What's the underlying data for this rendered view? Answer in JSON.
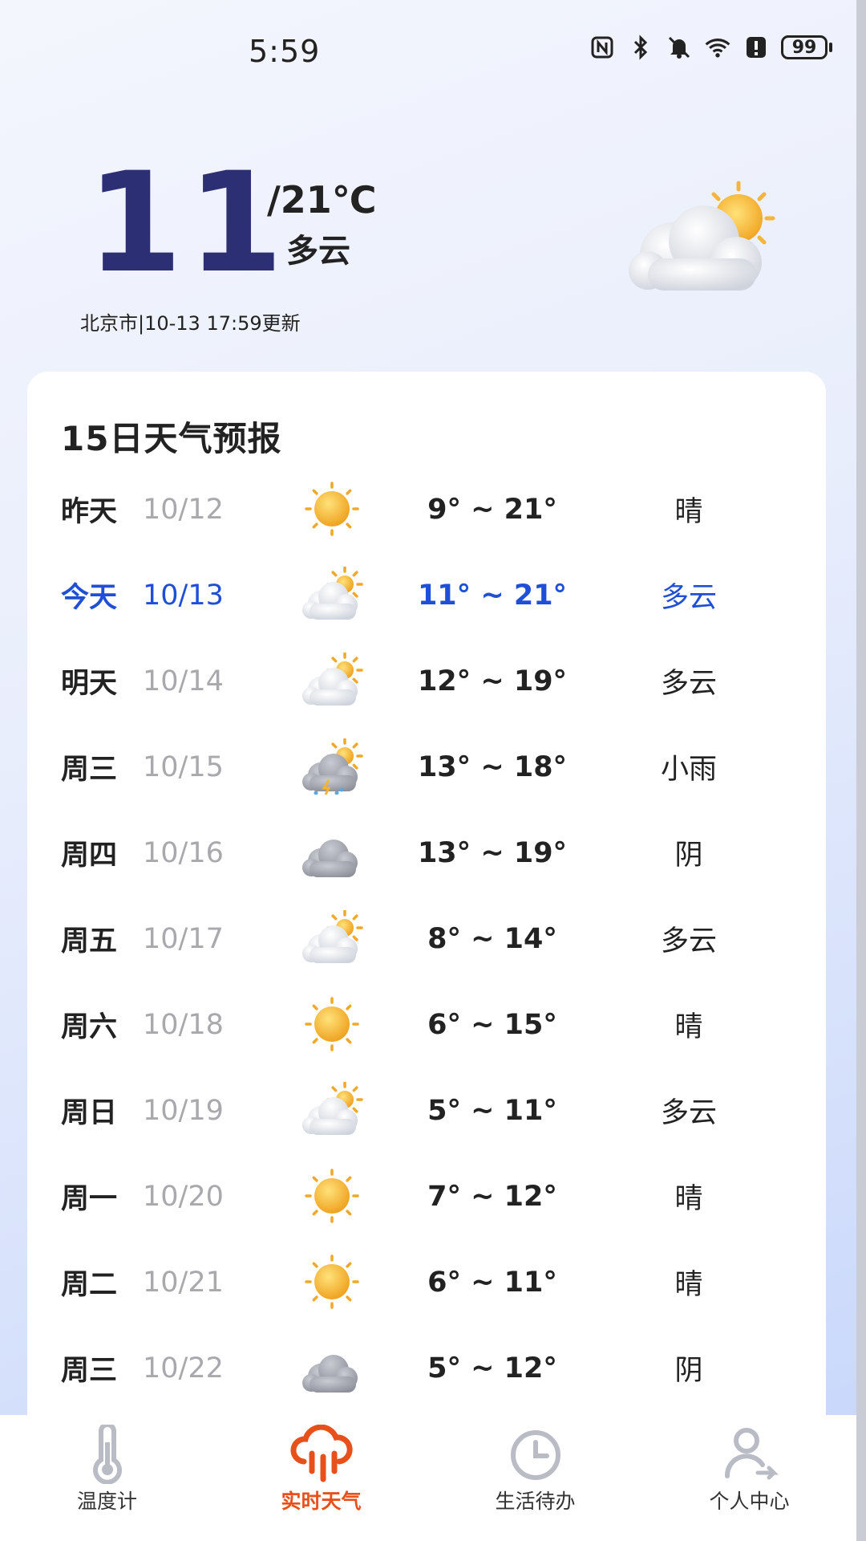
{
  "status_bar": {
    "time": "5:59",
    "battery": "99",
    "icons": [
      "nfc-icon",
      "bluetooth-icon",
      "mute-icon",
      "wifi-icon",
      "alert-icon",
      "battery-icon"
    ]
  },
  "current": {
    "temp": "11",
    "range": "/21℃",
    "condition": "多云",
    "location_update": "北京市|10-13 17:59更新",
    "icon": "partly-cloudy-icon"
  },
  "forecast": {
    "title": "15日天气预报",
    "today_color": "#1f4fd6",
    "days": [
      {
        "day": "昨天",
        "date": "10/12",
        "icon": "sunny",
        "temp": "9° ~ 21°",
        "cond": "晴"
      },
      {
        "day": "今天",
        "date": "10/13",
        "icon": "partly-cloudy",
        "temp": "11° ~ 21°",
        "cond": "多云"
      },
      {
        "day": "明天",
        "date": "10/14",
        "icon": "partly-cloudy",
        "temp": "12° ~ 19°",
        "cond": "多云"
      },
      {
        "day": "周三",
        "date": "10/15",
        "icon": "rain",
        "temp": "13° ~ 18°",
        "cond": "小雨"
      },
      {
        "day": "周四",
        "date": "10/16",
        "icon": "overcast",
        "temp": "13° ~ 19°",
        "cond": "阴"
      },
      {
        "day": "周五",
        "date": "10/17",
        "icon": "partly-cloudy",
        "temp": "8° ~ 14°",
        "cond": "多云"
      },
      {
        "day": "周六",
        "date": "10/18",
        "icon": "sunny",
        "temp": "6° ~ 15°",
        "cond": "晴"
      },
      {
        "day": "周日",
        "date": "10/19",
        "icon": "partly-cloudy",
        "temp": "5° ~ 11°",
        "cond": "多云"
      },
      {
        "day": "周一",
        "date": "10/20",
        "icon": "sunny",
        "temp": "7° ~ 12°",
        "cond": "晴"
      },
      {
        "day": "周二",
        "date": "10/21",
        "icon": "sunny",
        "temp": "6° ~ 11°",
        "cond": "晴"
      },
      {
        "day": "周三",
        "date": "10/22",
        "icon": "overcast",
        "temp": "5° ~ 12°",
        "cond": "阴"
      }
    ]
  },
  "nav": {
    "active_color": "#e8501b",
    "items": [
      {
        "label": "温度计",
        "icon": "thermometer-icon"
      },
      {
        "label": "实时天气",
        "icon": "weather-cloud-icon"
      },
      {
        "label": "生活待办",
        "icon": "clock-icon"
      },
      {
        "label": "个人中心",
        "icon": "user-icon"
      }
    ]
  }
}
